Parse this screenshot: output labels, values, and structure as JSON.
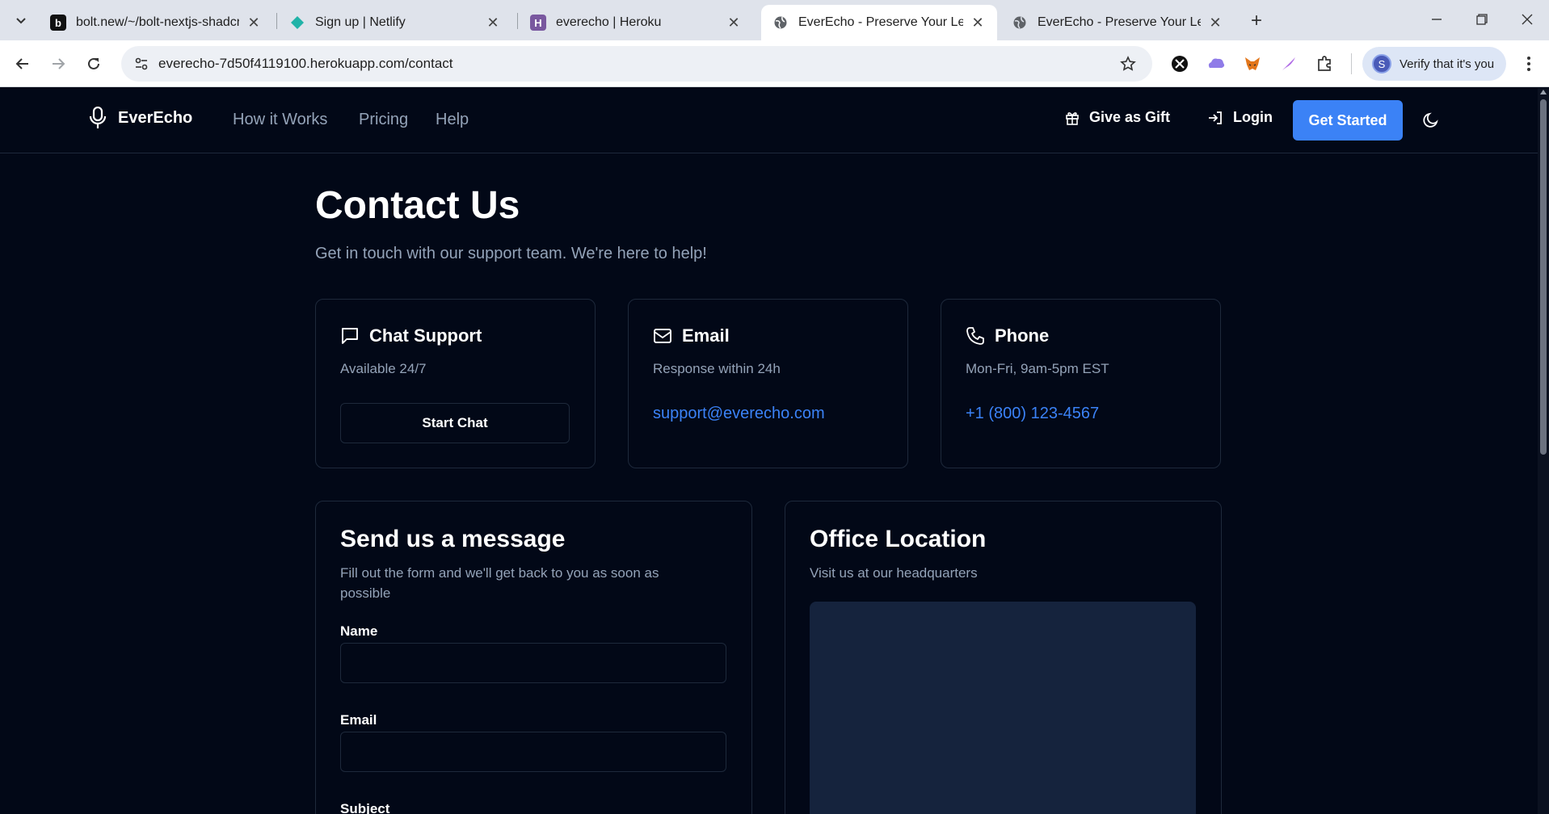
{
  "browser": {
    "tabs": [
      {
        "title": "bolt.new/~/bolt-nextjs-shadcn-",
        "favicon": "b",
        "favicon_color": "#111111"
      },
      {
        "title": "Sign up | Netlify",
        "favicon": "",
        "favicon_color": "#21b3a8"
      },
      {
        "title": "everecho | Heroku",
        "favicon": "H",
        "favicon_color": "#79589f"
      },
      {
        "title": "EverEcho - Preserve Your Legacy",
        "favicon": "",
        "favicon_color": "#5f6368",
        "active": true
      },
      {
        "title": "EverEcho - Preserve Your Legacy",
        "favicon": "",
        "favicon_color": "#5f6368"
      }
    ],
    "url": "everecho-7d50f4119100.herokuapp.com/contact",
    "profile_button": "Verify that it's you",
    "profile_initial": "S"
  },
  "header": {
    "brand": "EverEcho",
    "nav": [
      "How it Works",
      "Pricing",
      "Help"
    ],
    "gift": "Give as Gift",
    "login": "Login",
    "cta": "Get Started"
  },
  "page": {
    "title": "Contact Us",
    "subtitle": "Get in touch with our support team. We're here to help!"
  },
  "cards": {
    "chat": {
      "title": "Chat Support",
      "desc": "Available 24/7",
      "button": "Start Chat"
    },
    "email": {
      "title": "Email",
      "desc": "Response within 24h",
      "link": "support@everecho.com"
    },
    "phone": {
      "title": "Phone",
      "desc": "Mon-Fri, 9am-5pm EST",
      "link": "+1 (800) 123-4567"
    }
  },
  "form": {
    "title": "Send us a message",
    "subtitle": "Fill out the form and we'll get back to you as soon as possible",
    "name_label": "Name",
    "name_value": "",
    "email_label": "Email",
    "email_value": "",
    "subject_label": "Subject"
  },
  "office": {
    "title": "Office Location",
    "subtitle": "Visit us at our headquarters"
  },
  "colors": {
    "background": "#020817",
    "accent": "#3b82f6",
    "muted_text": "#94a3b8",
    "border": "#1e293b"
  }
}
